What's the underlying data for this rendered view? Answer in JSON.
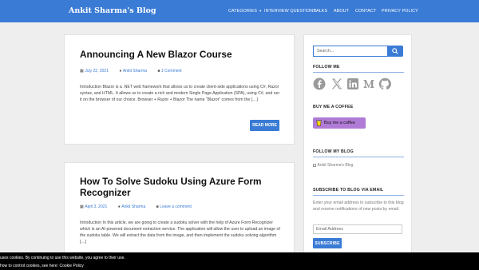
{
  "header": {
    "brand": "Ankit Sharma's Blog",
    "nav": [
      {
        "label": "CATEGORIES",
        "has_caret": true
      },
      {
        "label": "INTERVIEW QUESTIONS"
      },
      {
        "label": "TALKS"
      },
      {
        "label": "ABOUT"
      },
      {
        "label": "CONTACT"
      },
      {
        "label": "PRIVACY POLICY"
      }
    ],
    "caret": "▾",
    "color": "#3a7bd5"
  },
  "posts": [
    {
      "title": "Announcing A New Blazor Course",
      "date": "July 22, 2021",
      "author": "Ankit Sharma",
      "comments": "1 Comment",
      "excerpt": "Introduction Blazor is a .NET web framework that allows us to create client-side applications using C#, Razor syntax, and HTML. It allows us to create a rich and modern Single Page Application (SPA), using C#, and run it on the browser of our choice. Browser + Razor + Blazor The name “Blazor” comes from the […]",
      "read_more": "READ MORE"
    },
    {
      "title": "How To Solve Sudoku Using Azure Form Recognizer",
      "date": "April 3, 2021",
      "author": "Ankit Sharma",
      "comments": "Leave a comment",
      "excerpt": "Introduction In this article, we are going to create a sudoku solver with the help of Azure Form Recognizer which is an AI-powered document extraction service. The application will allow the user to upload an image of the sudoku table. We will extract the data from the image, and then implement the sudoku solving algorithm […]"
    }
  ],
  "sidebar": {
    "search_placeholder": "Search...",
    "follow_title": "FOLLOW ME",
    "social_icons": [
      "facebook-icon",
      "x-icon",
      "linkedin-icon",
      "medium-icon",
      "github-icon"
    ],
    "coffee_title": "BUY ME A COFFEE",
    "coffee_button": "Buy me a coffee",
    "blog_title": "FOLLOW MY BLOG",
    "blog_image_alt": "Ankit Sharma's Blog",
    "subscribe_title": "SUBSCRIBE TO BLOG VIA EMAIL",
    "subscribe_text": "Enter your email address to subscribe to this blog and receive notifications of new posts by email.",
    "email_placeholder": "Email Address",
    "subscribe_button": "SUBSCRIBE"
  },
  "cookie": {
    "line1": "uses cookies. By continuing to use this website, you agree to their use.",
    "line2_prefix": "how to control cookies, see here: ",
    "line2_link": "Cookie Policy"
  },
  "colors": {
    "accent": "#3a7bd5",
    "coffee": "#b07bd6"
  }
}
